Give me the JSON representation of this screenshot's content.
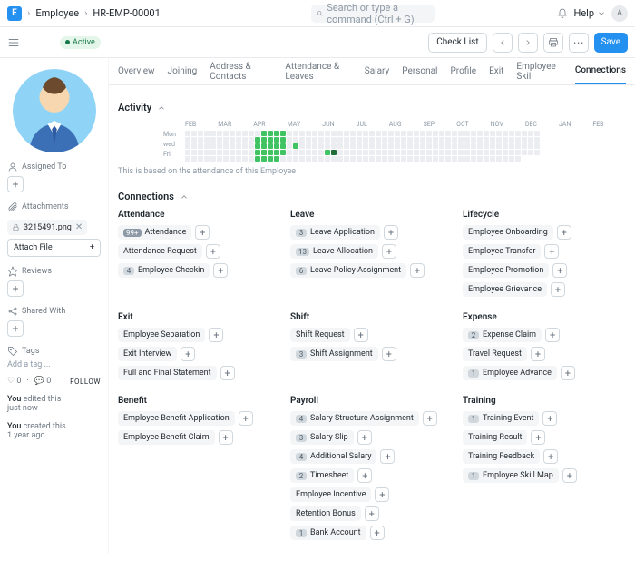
{
  "topbar": {
    "logo": "E",
    "crumbs": [
      "Employee",
      "HR-EMP-00001"
    ],
    "search_placeholder": "Search or type a command (Ctrl + G)",
    "help": "Help",
    "avatar": "A"
  },
  "toolbar": {
    "status": "Active",
    "checklist": "Check List",
    "save": "Save"
  },
  "tabs": [
    "Overview",
    "Joining",
    "Address & Contacts",
    "Attendance & Leaves",
    "Salary",
    "Personal",
    "Profile",
    "Exit",
    "Employee Skill",
    "Connections"
  ],
  "active_tab": 9,
  "activity": {
    "title": "Activity",
    "months": [
      "FEB",
      "MAR",
      "APR",
      "MAY",
      "JUN",
      "JUL",
      "AUG",
      "SEP",
      "OCT",
      "NOV",
      "DEC",
      "JAN",
      "FEB"
    ],
    "days": [
      "Mon",
      "wed",
      "Fri"
    ],
    "note": "This is based on the attendance of this Employee"
  },
  "sidebar": {
    "assigned": "Assigned To",
    "attachments": {
      "label": "Attachments",
      "file": "3215491.png",
      "attach": "Attach File"
    },
    "reviews": "Reviews",
    "shared": "Shared With",
    "tags": {
      "label": "Tags",
      "add": "Add a tag ..."
    },
    "like": "0",
    "comm": "0",
    "follow": "FOLLOW",
    "edited": [
      "You",
      "edited this",
      "just now"
    ],
    "created": [
      "You",
      "created this",
      "1 year ago"
    ]
  },
  "connections": {
    "title": "Connections",
    "groups": [
      {
        "title": "Attendance",
        "items": [
          {
            "count": "99+",
            "label": "Attendance",
            "hl": true
          },
          {
            "label": "Attendance Request"
          },
          {
            "count": "4",
            "label": "Employee Checkin"
          }
        ]
      },
      {
        "title": "Leave",
        "items": [
          {
            "count": "3",
            "label": "Leave Application"
          },
          {
            "count": "13",
            "label": "Leave Allocation"
          },
          {
            "count": "6",
            "label": "Leave Policy Assignment"
          }
        ]
      },
      {
        "title": "Lifecycle",
        "items": [
          {
            "label": "Employee Onboarding"
          },
          {
            "label": "Employee Transfer"
          },
          {
            "label": "Employee Promotion"
          },
          {
            "label": "Employee Grievance"
          }
        ]
      },
      {
        "title": "Exit",
        "items": [
          {
            "label": "Employee Separation"
          },
          {
            "label": "Exit Interview"
          },
          {
            "label": "Full and Final Statement"
          }
        ]
      },
      {
        "title": "Shift",
        "items": [
          {
            "label": "Shift Request"
          },
          {
            "count": "3",
            "label": "Shift Assignment"
          }
        ]
      },
      {
        "title": "Expense",
        "items": [
          {
            "count": "2",
            "label": "Expense Claim"
          },
          {
            "label": "Travel Request"
          },
          {
            "count": "1",
            "label": "Employee Advance"
          }
        ]
      },
      {
        "title": "Benefit",
        "items": [
          {
            "label": "Employee Benefit Application"
          },
          {
            "label": "Employee Benefit Claim"
          }
        ]
      },
      {
        "title": "Payroll",
        "items": [
          {
            "count": "4",
            "label": "Salary Structure Assignment"
          },
          {
            "count": "3",
            "label": "Salary Slip"
          },
          {
            "count": "4",
            "label": "Additional Salary"
          },
          {
            "count": "2",
            "label": "Timesheet"
          },
          {
            "label": "Employee Incentive"
          },
          {
            "label": "Retention Bonus"
          },
          {
            "count": "1",
            "label": "Bank Account"
          }
        ]
      },
      {
        "title": "Training",
        "items": [
          {
            "count": "1",
            "label": "Training Event"
          },
          {
            "label": "Training Result"
          },
          {
            "label": "Training Feedback"
          },
          {
            "count": "1",
            "label": "Employee Skill Map"
          }
        ]
      }
    ]
  },
  "heatmap_cols": [
    "00000",
    "00000",
    "00000",
    "00000",
    "00000",
    "00000",
    "00000",
    "00000",
    "00000",
    "00000",
    "00000",
    "02222",
    "22222",
    "22222",
    "22222",
    "22220",
    "00000",
    "00200",
    "00000",
    "00000",
    "00000",
    "00000",
    "00020",
    "00040",
    "00000",
    "00000",
    "00000",
    "00000",
    "00000",
    "00000",
    "00000",
    "00000",
    "00000",
    "00000",
    "00000",
    "00000",
    "00000",
    "00000",
    "00000",
    "00000",
    "00000",
    "00000",
    "00000",
    "00000",
    "00000",
    "00000",
    "00000",
    "00000",
    "00000",
    "00000",
    "00000",
    "00000",
    "00000",
    "0000",
    "0000",
    "0000"
  ]
}
